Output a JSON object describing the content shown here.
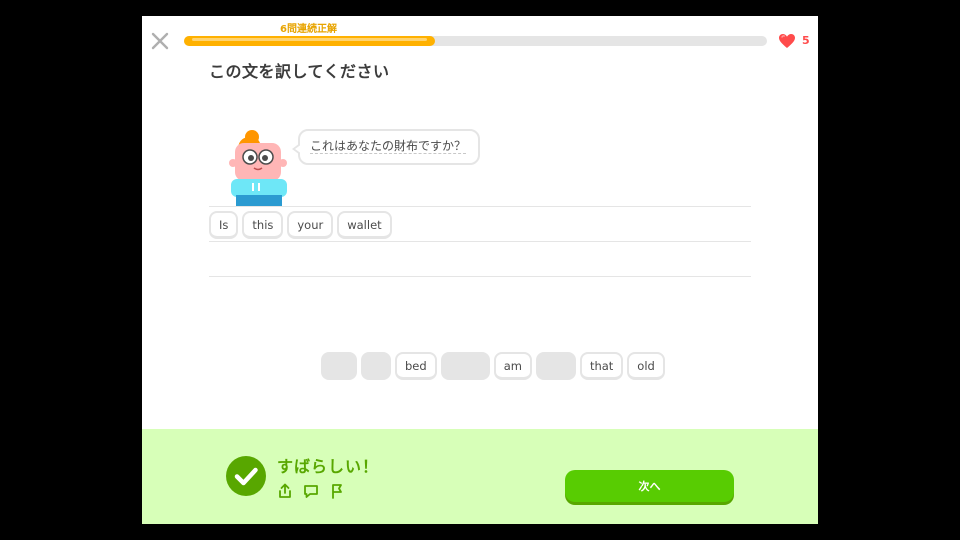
{
  "header": {
    "streak_label": "6問連続正解",
    "progress_fraction": 0.43,
    "hearts_count": "5"
  },
  "prompt": {
    "title": "この文を訳してください",
    "speech_text": "これはあなたの財布ですか？"
  },
  "answer": {
    "tiles": [
      "Is",
      "this",
      "your",
      "wallet"
    ]
  },
  "word_bank": {
    "tiles": [
      "bed",
      "am",
      "that",
      "old"
    ]
  },
  "feedback": {
    "message": "すばらしい！",
    "next_label": "次へ"
  },
  "colors": {
    "progress": "#ffb100",
    "heart": "#ff4b4b",
    "feedback_bg": "#d7ffb8",
    "feedback_text": "#58a700",
    "next_button": "#58cc02"
  },
  "icons": [
    "close-icon",
    "heart-icon",
    "checkmark-icon",
    "share-icon",
    "comment-icon",
    "report-flag-icon"
  ]
}
